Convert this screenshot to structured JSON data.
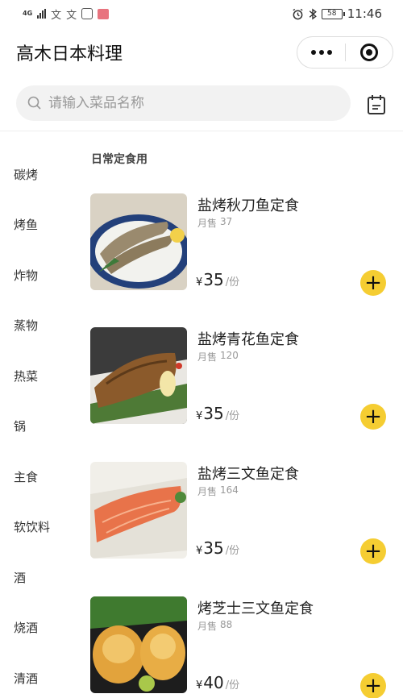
{
  "status": {
    "network": "4G",
    "time": "11:46",
    "battery": "58"
  },
  "header": {
    "title": "高木日本料理"
  },
  "search": {
    "placeholder": "请输入菜品名称"
  },
  "categories": [
    "碳烤",
    "烤鱼",
    "炸物",
    "蒸物",
    "热菜",
    "锅",
    "主食",
    "软饮料",
    "酒",
    "烧酒",
    "清酒"
  ],
  "section": {
    "title": "日常定食用"
  },
  "dishes": [
    {
      "name": "盐烤秋刀鱼定食",
      "sold_label": "月售",
      "sold": "37",
      "currency": "¥",
      "price": "35",
      "unit": "/份"
    },
    {
      "name": "盐烤青花鱼定食",
      "sold_label": "月售",
      "sold": "120",
      "currency": "¥",
      "price": "35",
      "unit": "/份"
    },
    {
      "name": "盐烤三文鱼定食",
      "sold_label": "月售",
      "sold": "164",
      "currency": "¥",
      "price": "35",
      "unit": "/份"
    },
    {
      "name": "烤芝士三文鱼定食",
      "sold_label": "月售",
      "sold": "88",
      "currency": "¥",
      "price": "40",
      "unit": "/份"
    }
  ],
  "colors": {
    "accent": "#f5cd32",
    "search_bg": "#f2f2f2"
  }
}
